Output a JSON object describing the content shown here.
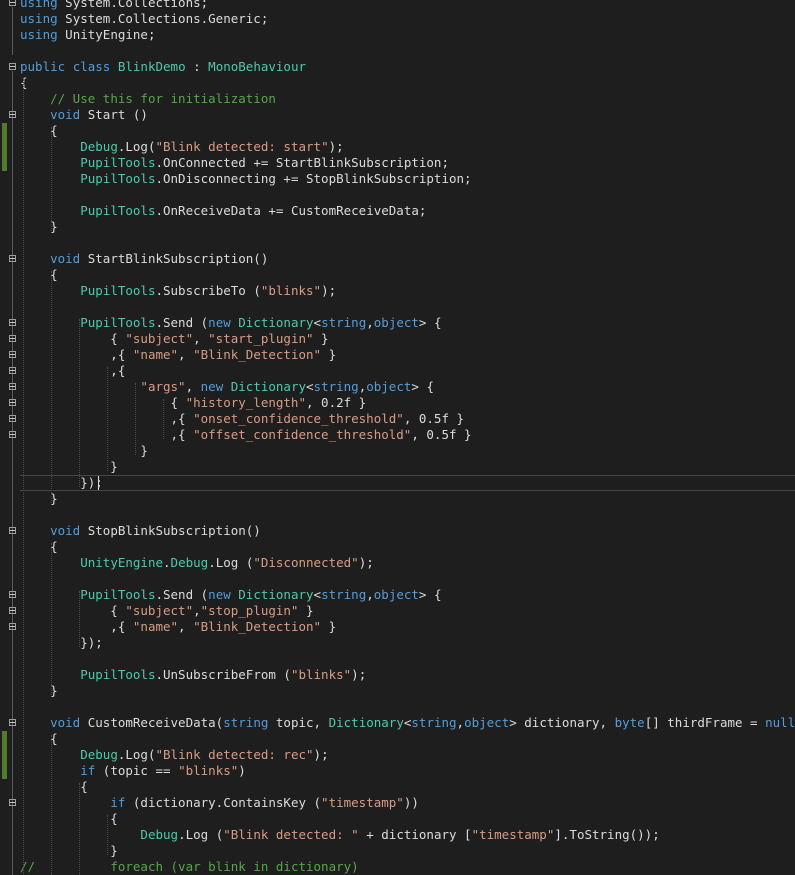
{
  "editor": {
    "language": "C#",
    "colors": {
      "background": "#1e1e1e",
      "keyword": "#569cd6",
      "type": "#4ec9b0",
      "string": "#d69d85",
      "comment": "#57a64a",
      "plain": "#dcdcdc",
      "change_marker": "#4f7b2a"
    },
    "lines": [
      {
        "fold": true,
        "tokens": [
          [
            "k",
            "using"
          ],
          [
            "p",
            " System.Collections;"
          ]
        ]
      },
      {
        "fold": false,
        "tokens": [
          [
            "k",
            "using"
          ],
          [
            "p",
            " System.Collections.Generic;"
          ]
        ]
      },
      {
        "fold": false,
        "tokens": [
          [
            "k",
            "using"
          ],
          [
            "p",
            " UnityEngine;"
          ]
        ]
      },
      {
        "fold": false,
        "tokens": []
      },
      {
        "fold": true,
        "tokens": [
          [
            "k",
            "public"
          ],
          [
            "p",
            " "
          ],
          [
            "k",
            "class"
          ],
          [
            "p",
            " "
          ],
          [
            "t",
            "BlinkDemo"
          ],
          [
            "p",
            " : "
          ],
          [
            "t",
            "MonoBehaviour"
          ]
        ]
      },
      {
        "fold": false,
        "tokens": [
          [
            "p",
            "{"
          ]
        ]
      },
      {
        "fold": false,
        "tokens": [
          [
            "p",
            "    "
          ],
          [
            "c",
            "// Use this for initialization"
          ]
        ]
      },
      {
        "fold": true,
        "tokens": [
          [
            "p",
            "    "
          ],
          [
            "k",
            "void"
          ],
          [
            "p",
            " Start ()"
          ]
        ]
      },
      {
        "fold": false,
        "tokens": [
          [
            "p",
            "    {"
          ]
        ]
      },
      {
        "fold": false,
        "tokens": [
          [
            "p",
            "        "
          ],
          [
            "t",
            "Debug"
          ],
          [
            "p",
            ".Log("
          ],
          [
            "s",
            "\"Blink detected: start\""
          ],
          [
            "p",
            ");"
          ]
        ]
      },
      {
        "fold": false,
        "tokens": [
          [
            "p",
            "        "
          ],
          [
            "t",
            "PupilTools"
          ],
          [
            "p",
            ".OnConnected += StartBlinkSubscription;"
          ]
        ]
      },
      {
        "fold": false,
        "tokens": [
          [
            "p",
            "        "
          ],
          [
            "t",
            "PupilTools"
          ],
          [
            "p",
            ".OnDisconnecting += StopBlinkSubscription;"
          ]
        ]
      },
      {
        "fold": false,
        "tokens": []
      },
      {
        "fold": false,
        "tokens": [
          [
            "p",
            "        "
          ],
          [
            "t",
            "PupilTools"
          ],
          [
            "p",
            ".OnReceiveData += CustomReceiveData;"
          ]
        ]
      },
      {
        "fold": false,
        "tokens": [
          [
            "p",
            "    }"
          ]
        ]
      },
      {
        "fold": false,
        "tokens": []
      },
      {
        "fold": true,
        "tokens": [
          [
            "p",
            "    "
          ],
          [
            "k",
            "void"
          ],
          [
            "p",
            " StartBlinkSubscription()"
          ]
        ]
      },
      {
        "fold": false,
        "tokens": [
          [
            "p",
            "    {"
          ]
        ]
      },
      {
        "fold": false,
        "tokens": [
          [
            "p",
            "        "
          ],
          [
            "t",
            "PupilTools"
          ],
          [
            "p",
            ".SubscribeTo ("
          ],
          [
            "s",
            "\"blinks\""
          ],
          [
            "p",
            ");"
          ]
        ]
      },
      {
        "fold": false,
        "tokens": []
      },
      {
        "fold": true,
        "tokens": [
          [
            "p",
            "        "
          ],
          [
            "t",
            "PupilTools"
          ],
          [
            "p",
            ".Send ("
          ],
          [
            "k",
            "new"
          ],
          [
            "p",
            " "
          ],
          [
            "t",
            "Dictionary"
          ],
          [
            "p",
            "<"
          ],
          [
            "k",
            "string"
          ],
          [
            "p",
            ","
          ],
          [
            "k",
            "object"
          ],
          [
            "p",
            "> {"
          ]
        ]
      },
      {
        "fold": true,
        "tokens": [
          [
            "p",
            "            { "
          ],
          [
            "s",
            "\"subject\""
          ],
          [
            "p",
            ", "
          ],
          [
            "s",
            "\"start_plugin\""
          ],
          [
            "p",
            " }"
          ]
        ]
      },
      {
        "fold": true,
        "tokens": [
          [
            "p",
            "            ,{ "
          ],
          [
            "s",
            "\"name\""
          ],
          [
            "p",
            ", "
          ],
          [
            "s",
            "\"Blink_Detection\""
          ],
          [
            "p",
            " }"
          ]
        ]
      },
      {
        "fold": true,
        "tokens": [
          [
            "p",
            "            ,{"
          ]
        ]
      },
      {
        "fold": true,
        "tokens": [
          [
            "p",
            "                "
          ],
          [
            "s",
            "\"args\""
          ],
          [
            "p",
            ", "
          ],
          [
            "k",
            "new"
          ],
          [
            "p",
            " "
          ],
          [
            "t",
            "Dictionary"
          ],
          [
            "p",
            "<"
          ],
          [
            "k",
            "string"
          ],
          [
            "p",
            ","
          ],
          [
            "k",
            "object"
          ],
          [
            "p",
            "> {"
          ]
        ]
      },
      {
        "fold": true,
        "tokens": [
          [
            "p",
            "                    { "
          ],
          [
            "s",
            "\"history_length\""
          ],
          [
            "p",
            ", 0.2f }"
          ]
        ]
      },
      {
        "fold": true,
        "tokens": [
          [
            "p",
            "                    ,{ "
          ],
          [
            "s",
            "\"onset_confidence_threshold\""
          ],
          [
            "p",
            ", 0.5f }"
          ]
        ]
      },
      {
        "fold": true,
        "tokens": [
          [
            "p",
            "                    ,{ "
          ],
          [
            "s",
            "\"offset_confidence_threshold\""
          ],
          [
            "p",
            ", 0.5f }"
          ]
        ]
      },
      {
        "fold": false,
        "tokens": [
          [
            "p",
            "                }"
          ]
        ]
      },
      {
        "fold": false,
        "tokens": [
          [
            "p",
            "            }"
          ]
        ]
      },
      {
        "fold": false,
        "tokens": [
          [
            "p",
            "        });"
          ]
        ]
      },
      {
        "fold": false,
        "tokens": [
          [
            "p",
            "    }"
          ]
        ]
      },
      {
        "fold": false,
        "tokens": []
      },
      {
        "fold": true,
        "tokens": [
          [
            "p",
            "    "
          ],
          [
            "k",
            "void"
          ],
          [
            "p",
            " StopBlinkSubscription()"
          ]
        ]
      },
      {
        "fold": false,
        "tokens": [
          [
            "p",
            "    {"
          ]
        ]
      },
      {
        "fold": false,
        "tokens": [
          [
            "p",
            "        "
          ],
          [
            "t",
            "UnityEngine"
          ],
          [
            "p",
            "."
          ],
          [
            "t",
            "Debug"
          ],
          [
            "p",
            ".Log ("
          ],
          [
            "s",
            "\"Disconnected\""
          ],
          [
            "p",
            ");"
          ]
        ]
      },
      {
        "fold": false,
        "tokens": []
      },
      {
        "fold": true,
        "tokens": [
          [
            "p",
            "        "
          ],
          [
            "t",
            "PupilTools"
          ],
          [
            "p",
            ".Send ("
          ],
          [
            "k",
            "new"
          ],
          [
            "p",
            " "
          ],
          [
            "t",
            "Dictionary"
          ],
          [
            "p",
            "<"
          ],
          [
            "k",
            "string"
          ],
          [
            "p",
            ","
          ],
          [
            "k",
            "object"
          ],
          [
            "p",
            "> {"
          ]
        ]
      },
      {
        "fold": true,
        "tokens": [
          [
            "p",
            "            { "
          ],
          [
            "s",
            "\"subject\""
          ],
          [
            "p",
            ","
          ],
          [
            "s",
            "\"stop_plugin\""
          ],
          [
            "p",
            " }"
          ]
        ]
      },
      {
        "fold": true,
        "tokens": [
          [
            "p",
            "            ,{ "
          ],
          [
            "s",
            "\"name\""
          ],
          [
            "p",
            ", "
          ],
          [
            "s",
            "\"Blink_Detection\""
          ],
          [
            "p",
            " }"
          ]
        ]
      },
      {
        "fold": false,
        "tokens": [
          [
            "p",
            "        });"
          ]
        ]
      },
      {
        "fold": false,
        "tokens": []
      },
      {
        "fold": false,
        "tokens": [
          [
            "p",
            "        "
          ],
          [
            "t",
            "PupilTools"
          ],
          [
            "p",
            ".UnSubscribeFrom ("
          ],
          [
            "s",
            "\"blinks\""
          ],
          [
            "p",
            ");"
          ]
        ]
      },
      {
        "fold": false,
        "tokens": [
          [
            "p",
            "    }"
          ]
        ]
      },
      {
        "fold": false,
        "tokens": []
      },
      {
        "fold": true,
        "tokens": [
          [
            "p",
            "    "
          ],
          [
            "k",
            "void"
          ],
          [
            "p",
            " CustomReceiveData("
          ],
          [
            "k",
            "string"
          ],
          [
            "p",
            " topic, "
          ],
          [
            "t",
            "Dictionary"
          ],
          [
            "p",
            "<"
          ],
          [
            "k",
            "string"
          ],
          [
            "p",
            ","
          ],
          [
            "k",
            "object"
          ],
          [
            "p",
            "> dictionary, "
          ],
          [
            "k",
            "byte"
          ],
          [
            "p",
            "[] thirdFrame = "
          ],
          [
            "k",
            "null"
          ],
          [
            "p",
            ")"
          ]
        ]
      },
      {
        "fold": false,
        "tokens": [
          [
            "p",
            "    {"
          ]
        ]
      },
      {
        "fold": false,
        "tokens": [
          [
            "p",
            "        "
          ],
          [
            "t",
            "Debug"
          ],
          [
            "p",
            ".Log("
          ],
          [
            "s",
            "\"Blink detected: rec\""
          ],
          [
            "p",
            ");"
          ]
        ]
      },
      {
        "fold": false,
        "tokens": [
          [
            "p",
            "        "
          ],
          [
            "k",
            "if"
          ],
          [
            "p",
            " (topic == "
          ],
          [
            "s",
            "\"blinks\""
          ],
          [
            "p",
            ")"
          ]
        ]
      },
      {
        "fold": false,
        "tokens": [
          [
            "p",
            "        {"
          ]
        ]
      },
      {
        "fold": true,
        "tokens": [
          [
            "p",
            "            "
          ],
          [
            "k",
            "if"
          ],
          [
            "p",
            " (dictionary.ContainsKey ("
          ],
          [
            "s",
            "\"timestamp\""
          ],
          [
            "p",
            "))"
          ]
        ]
      },
      {
        "fold": false,
        "tokens": [
          [
            "p",
            "            {"
          ]
        ]
      },
      {
        "fold": false,
        "tokens": [
          [
            "p",
            "                "
          ],
          [
            "t",
            "Debug"
          ],
          [
            "p",
            ".Log ("
          ],
          [
            "s",
            "\"Blink detected: \""
          ],
          [
            "p",
            " + dictionary ["
          ],
          [
            "s",
            "\"timestamp\""
          ],
          [
            "p",
            "].ToString());"
          ]
        ]
      },
      {
        "fold": false,
        "tokens": [
          [
            "p",
            "            }"
          ]
        ]
      },
      {
        "fold": false,
        "tokens": [
          [
            "c",
            "//"
          ],
          [
            "p",
            "          "
          ],
          [
            "c",
            "foreach (var blink in dictionary)"
          ]
        ]
      }
    ]
  }
}
